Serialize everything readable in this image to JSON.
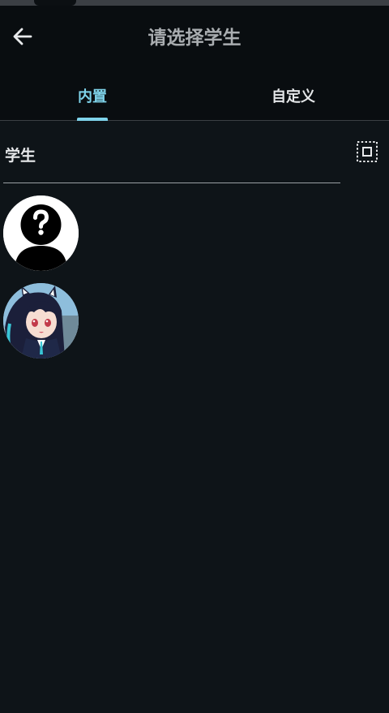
{
  "header": {
    "title": "请选择学生",
    "back_icon": "arrow-left-icon"
  },
  "tabs": [
    {
      "label": "内置",
      "active": true
    },
    {
      "label": "自定义",
      "active": false
    }
  ],
  "section": {
    "title": "学生",
    "select_icon": "select-all-icon"
  },
  "students": [
    {
      "avatar": "unknown-person-avatar"
    },
    {
      "avatar": "character-avatar"
    }
  ],
  "colors": {
    "background": "#0e1418",
    "app_bar": "#090d10",
    "accent": "#7ed3ea",
    "title_text": "#a9adb0",
    "text": "#e8eaec"
  }
}
